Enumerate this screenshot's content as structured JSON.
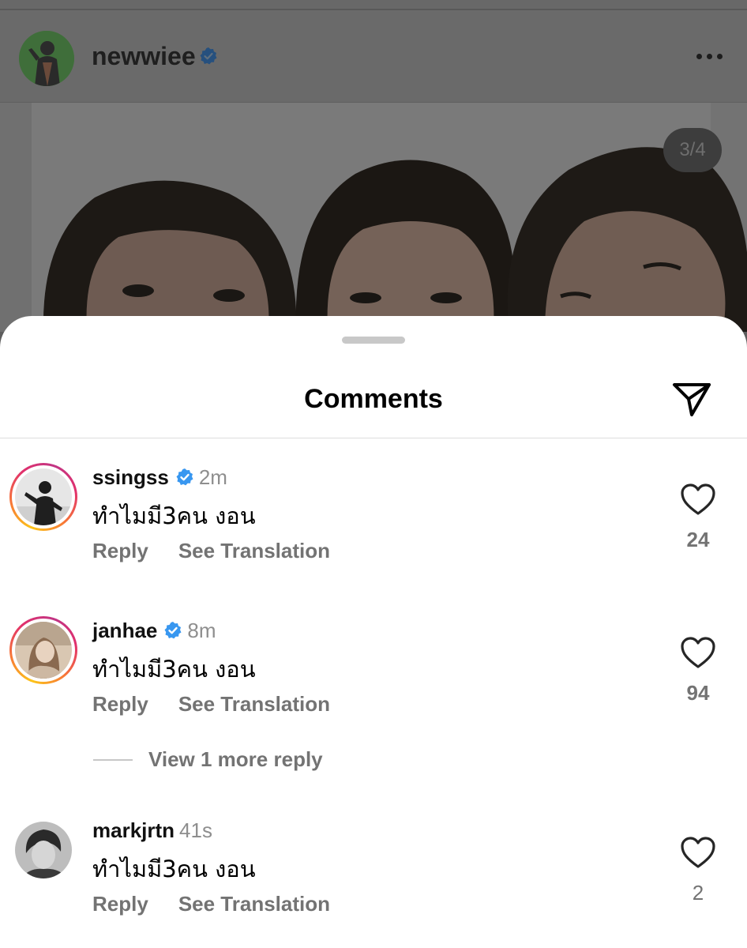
{
  "post": {
    "username": "newwiee",
    "verified": true,
    "page_counter": "3/4"
  },
  "sheet": {
    "title": "Comments"
  },
  "comments": [
    {
      "username": "ssingss",
      "verified": true,
      "time": "2m",
      "text": "ทำไมมี3คน งอน",
      "reply": "Reply",
      "translate": "See Translation",
      "likes": "24",
      "story_ring": true
    },
    {
      "username": "janhae",
      "verified": true,
      "time": "8m",
      "text": "ทำไมมี3คน งอน",
      "reply": "Reply",
      "translate": "See Translation",
      "likes": "94",
      "story_ring": true
    },
    {
      "username": "markjrtn",
      "verified": false,
      "time": "41s",
      "text": "ทำไมมี3คน งอน",
      "reply": "Reply",
      "translate": "See Translation",
      "likes": "2",
      "story_ring": false
    }
  ],
  "view_more_replies": "View 1 more reply",
  "colors": {
    "verified": "#3897f0",
    "secondary_text": "#737373"
  }
}
